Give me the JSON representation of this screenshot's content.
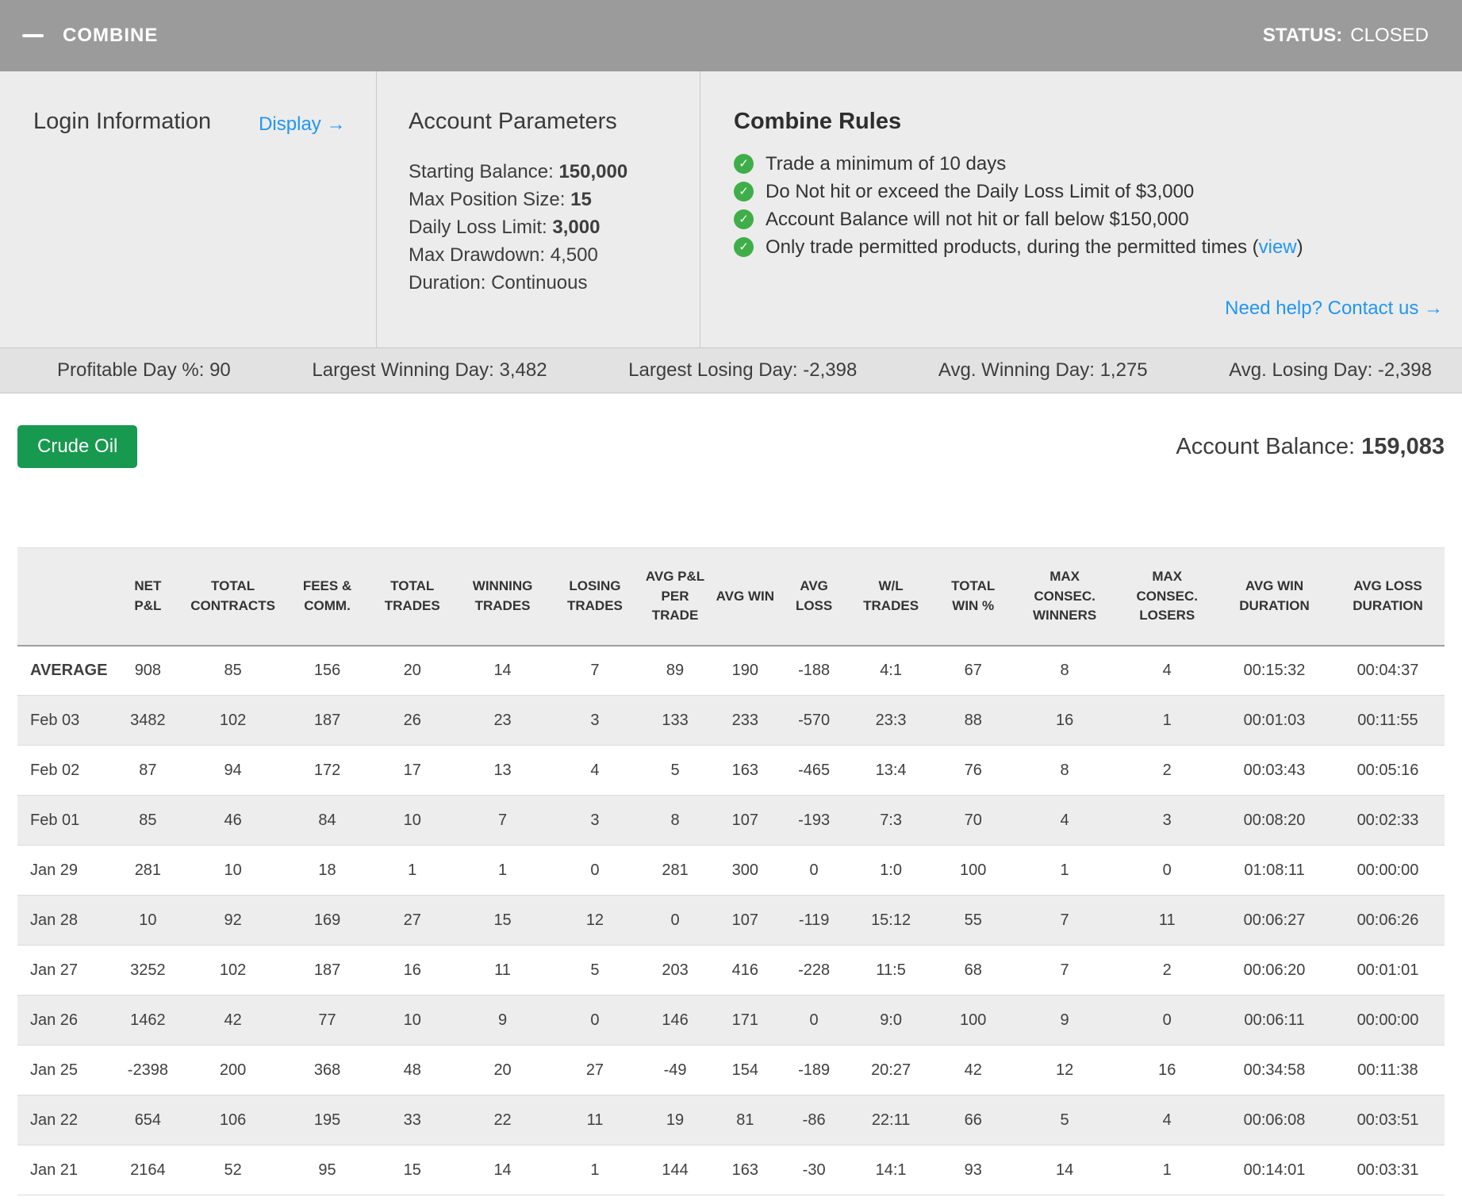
{
  "header": {
    "title": "COMBINE",
    "status_label": "STATUS:",
    "status_value": "CLOSED"
  },
  "icons": {
    "check": "✓"
  },
  "login": {
    "title": "Login Information",
    "display_link": "Display →"
  },
  "account_parameters": {
    "title": "Account Parameters",
    "items": [
      {
        "label": "Starting Balance:",
        "value": "150,000",
        "strong": true
      },
      {
        "label": "Max Position Size:",
        "value": "15",
        "strong": true
      },
      {
        "label": "Daily Loss Limit:",
        "value": "3,000",
        "strong": true
      },
      {
        "label": "Max Drawdown:",
        "value": "4,500",
        "strong": false
      },
      {
        "label": "Duration:",
        "value": "Continuous",
        "strong": false
      }
    ]
  },
  "combine_rules": {
    "title": "Combine Rules",
    "rules": [
      {
        "text": "Trade a minimum of 10 days"
      },
      {
        "text": "Do Not hit or exceed the Daily Loss Limit of $3,000"
      },
      {
        "text": "Account Balance will not hit or fall below $150,000"
      },
      {
        "pre": "Only trade permitted products, during the permitted times (",
        "link": "view",
        "post": ")"
      }
    ],
    "help_link": "Need help? Contact us →"
  },
  "stats_bar": [
    "Profitable Day %: 90",
    "Largest Winning Day: 3,482",
    "Largest Losing Day: -2,398",
    "Avg. Winning Day: 1,275",
    "Avg. Losing Day: -2,398"
  ],
  "product_button": "Crude Oil",
  "account_balance": {
    "label": "Account Balance:",
    "value": "159,083"
  },
  "table": {
    "columns": [
      "",
      "NET P&L",
      "TOTAL CONTRACTS",
      "FEES & COMM.",
      "TOTAL TRADES",
      "WINNING TRADES",
      "LOSING TRADES",
      "AVG P&L PER TRADE",
      "AVG WIN",
      "AVG LOSS",
      "W/L TRADES",
      "TOTAL WIN %",
      "MAX CONSEC. WINNERS",
      "MAX CONSEC. LOSERS",
      "AVG WIN DURATION",
      "AVG LOSS DURATION"
    ],
    "rows": [
      {
        "label": "AVERAGE",
        "bold": true,
        "values": [
          "908",
          "85",
          "156",
          "20",
          "14",
          "7",
          "89",
          "190",
          "-188",
          "4:1",
          "67",
          "8",
          "4",
          "00:15:32",
          "00:04:37"
        ]
      },
      {
        "label": "Feb 03",
        "bold": false,
        "values": [
          "3482",
          "102",
          "187",
          "26",
          "23",
          "3",
          "133",
          "233",
          "-570",
          "23:3",
          "88",
          "16",
          "1",
          "00:01:03",
          "00:11:55"
        ]
      },
      {
        "label": "Feb 02",
        "bold": false,
        "values": [
          "87",
          "94",
          "172",
          "17",
          "13",
          "4",
          "5",
          "163",
          "-465",
          "13:4",
          "76",
          "8",
          "2",
          "00:03:43",
          "00:05:16"
        ]
      },
      {
        "label": "Feb 01",
        "bold": false,
        "values": [
          "85",
          "46",
          "84",
          "10",
          "7",
          "3",
          "8",
          "107",
          "-193",
          "7:3",
          "70",
          "4",
          "3",
          "00:08:20",
          "00:02:33"
        ]
      },
      {
        "label": "Jan 29",
        "bold": false,
        "values": [
          "281",
          "10",
          "18",
          "1",
          "1",
          "0",
          "281",
          "300",
          "0",
          "1:0",
          "100",
          "1",
          "0",
          "01:08:11",
          "00:00:00"
        ]
      },
      {
        "label": "Jan 28",
        "bold": false,
        "values": [
          "10",
          "92",
          "169",
          "27",
          "15",
          "12",
          "0",
          "107",
          "-119",
          "15:12",
          "55",
          "7",
          "11",
          "00:06:27",
          "00:06:26"
        ]
      },
      {
        "label": "Jan 27",
        "bold": false,
        "values": [
          "3252",
          "102",
          "187",
          "16",
          "11",
          "5",
          "203",
          "416",
          "-228",
          "11:5",
          "68",
          "7",
          "2",
          "00:06:20",
          "00:01:01"
        ]
      },
      {
        "label": "Jan 26",
        "bold": false,
        "values": [
          "1462",
          "42",
          "77",
          "10",
          "9",
          "0",
          "146",
          "171",
          "0",
          "9:0",
          "100",
          "9",
          "0",
          "00:06:11",
          "00:00:00"
        ]
      },
      {
        "label": "Jan 25",
        "bold": false,
        "values": [
          "-2398",
          "200",
          "368",
          "48",
          "20",
          "27",
          "-49",
          "154",
          "-189",
          "20:27",
          "42",
          "12",
          "16",
          "00:34:58",
          "00:11:38"
        ]
      },
      {
        "label": "Jan 22",
        "bold": false,
        "values": [
          "654",
          "106",
          "195",
          "33",
          "22",
          "11",
          "19",
          "81",
          "-86",
          "22:11",
          "66",
          "5",
          "4",
          "00:06:08",
          "00:03:51"
        ]
      },
      {
        "label": "Jan 21",
        "bold": false,
        "values": [
          "2164",
          "52",
          "95",
          "15",
          "14",
          "1",
          "144",
          "163",
          "-30",
          "14:1",
          "93",
          "14",
          "1",
          "00:14:01",
          "00:03:31"
        ]
      }
    ]
  }
}
